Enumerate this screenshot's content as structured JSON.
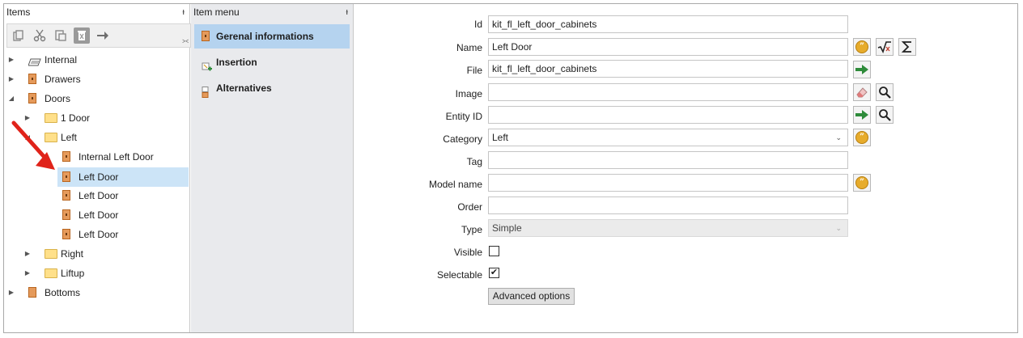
{
  "items_panel": {
    "title": "Items",
    "pin_glyph": "ᵱ",
    "toolbar": [
      {
        "icon": "copy-icon"
      },
      {
        "icon": "cut-icon"
      },
      {
        "icon": "paste-icon"
      },
      {
        "icon": "delete-icon"
      },
      {
        "icon": "arrow-right-icon"
      }
    ],
    "tree": [
      {
        "label": "Internal",
        "icon": "layers-icon",
        "expander": "▶",
        "level": 0
      },
      {
        "label": "Drawers",
        "icon": "cabinet-icon",
        "expander": "▶",
        "level": 0
      },
      {
        "label": "Doors",
        "icon": "cabinet-icon",
        "expander": "◢",
        "level": 0
      },
      {
        "label": "1 Door",
        "icon": "folder-icon",
        "expander": "▶",
        "level": 1
      },
      {
        "label": "Left",
        "icon": "folder-icon",
        "expander": "◢",
        "level": 1
      },
      {
        "label": "Internal Left Door",
        "icon": "cabinet-icon",
        "level": 2
      },
      {
        "label": "Left Door",
        "icon": "cabinet-icon",
        "level": 2,
        "selected": true
      },
      {
        "label": "Left Door",
        "icon": "cabinet-icon",
        "level": 2
      },
      {
        "label": "Left Door",
        "icon": "cabinet-icon",
        "level": 2
      },
      {
        "label": "Left Door",
        "icon": "cabinet-icon",
        "level": 2
      },
      {
        "label": "Right",
        "icon": "folder-icon",
        "expander": "▶",
        "level": 1
      },
      {
        "label": "Liftup",
        "icon": "folder-icon",
        "expander": "▶",
        "level": 1
      },
      {
        "label": "Bottoms",
        "icon": "cabinet-icon",
        "expander": "▶",
        "level": 0
      }
    ]
  },
  "menu_panel": {
    "title": "Item menu",
    "items": [
      {
        "label": "Gerenal informations",
        "icon": "cabinet-icon",
        "active": true
      },
      {
        "label": "Insertion",
        "icon": "insertion-icon"
      },
      {
        "label": "Alternatives",
        "icon": "alternatives-icon"
      }
    ]
  },
  "form": {
    "id_label": "Id",
    "id_value": "kit_fl_left_door_cabinets",
    "name_label": "Name",
    "name_value": "Left Door",
    "file_label": "File",
    "file_value": "kit_fl_left_door_cabinets",
    "image_label": "Image",
    "image_value": "",
    "entity_label": "Entity ID",
    "entity_value": "",
    "category_label": "Category",
    "category_value": "Left",
    "tag_label": "Tag",
    "tag_value": "",
    "model_label": "Model name",
    "model_value": "",
    "order_label": "Order",
    "order_value": "",
    "type_label": "Type",
    "type_value": "Simple",
    "visible_label": "Visible",
    "visible_checked": false,
    "selectable_label": "Selectable",
    "selectable_checked": true,
    "check_glyph": "✔",
    "chevron_glyph": "⌄",
    "advanced_label": "Advanced options"
  },
  "colors": {
    "selection": "#cce4f7",
    "menu_active": "#b5d3ef",
    "menu_bg": "#e9eaed",
    "quote_icon": "#e7ac2c",
    "green_arrow": "#2e8b3a",
    "annotation_arrow": "#e0231a"
  }
}
